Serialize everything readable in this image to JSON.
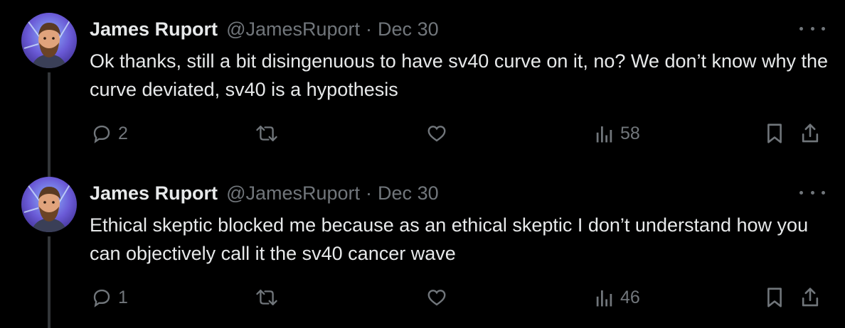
{
  "colors": {
    "background": "#000000",
    "text": "#e7e9ea",
    "muted": "#71767b",
    "thread_line": "#333639"
  },
  "tweets": [
    {
      "author": "James Ruport",
      "handle": "@JamesRuport",
      "separator": "·",
      "date": "Dec 30",
      "text": "Ok thanks, still a bit disingenuous to have sv40 curve on it, no? We don’t know why the curve deviated, sv40 is a hypothesis",
      "replies": "2",
      "views": "58",
      "icons": [
        "reply-icon",
        "retweet-icon",
        "like-icon",
        "views-icon",
        "bookmark-icon",
        "share-icon",
        "more-icon"
      ]
    },
    {
      "author": "James Ruport",
      "handle": "@JamesRuport",
      "separator": "·",
      "date": "Dec 30",
      "text": "Ethical skeptic blocked me because as an ethical skeptic I don’t understand how you can objectively call it the sv40 cancer wave",
      "replies": "1",
      "views": "46",
      "icons": [
        "reply-icon",
        "retweet-icon",
        "like-icon",
        "views-icon",
        "bookmark-icon",
        "share-icon",
        "more-icon"
      ]
    }
  ]
}
